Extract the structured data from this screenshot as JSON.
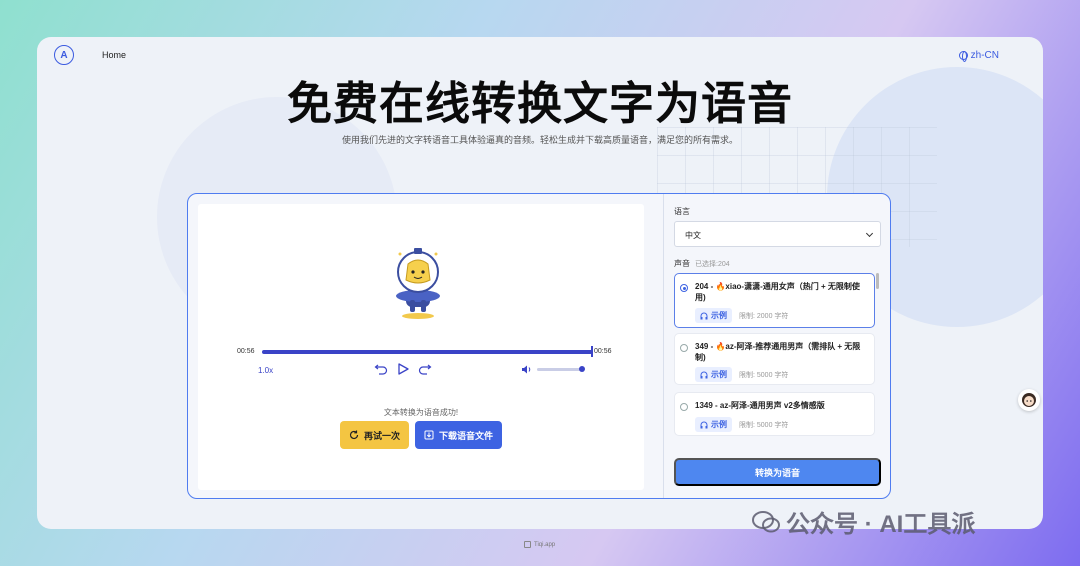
{
  "nav": {
    "home": "Home",
    "language": "zh-CN"
  },
  "hero": {
    "title": "免费在线转换文字为语音",
    "subtitle": "使用我们先进的文字转语音工具体验逼真的音频。轻松生成并下载高质量语音，满足您的所有需求。"
  },
  "player": {
    "current_time": "00:56",
    "duration": "00:56",
    "progress": 1.0,
    "speed": "1.0x",
    "volume": 1.0,
    "status": "文本转换为语音成功!",
    "retry_label": "再试一次",
    "download_label": "下载语音文件"
  },
  "settings": {
    "language_label": "语言",
    "language_value": "中文",
    "voice_label": "声音",
    "voice_selected": "已选择:204",
    "voices": [
      {
        "name": "204 - 🔥xiao-潇潇-通用女声（热门 + 无限制使用)",
        "demo": "示例",
        "limit": "限制: 2000 字符",
        "selected": true
      },
      {
        "name": "349 - 🔥az-阿泽-推荐通用男声（需排队 + 无限制)",
        "demo": "示例",
        "limit": "限制: 5000 字符",
        "selected": false
      },
      {
        "name": "1349 - az-阿泽-通用男声 v2多情感版",
        "demo": "示例",
        "limit": "限制: 5000 字符",
        "selected": false
      }
    ],
    "convert_label": "转换为语音"
  },
  "footer": {
    "text": "Tiqi.app"
  },
  "watermark": {
    "text": "公众号 · AI工具派"
  },
  "colors": {
    "accent": "#3d63e2",
    "retry": "#f4c542",
    "convert": "#4e87f0"
  }
}
